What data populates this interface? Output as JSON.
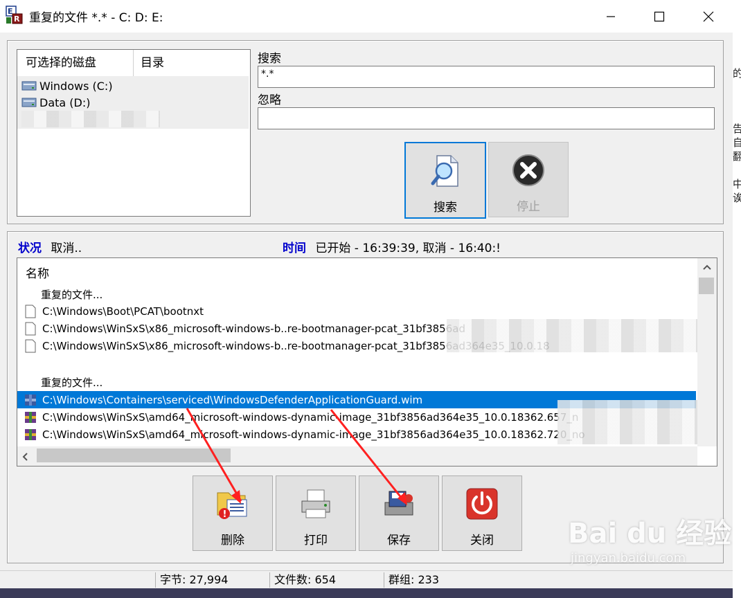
{
  "window": {
    "title": "重复的文件 *.* - C: D: E:",
    "minimize_glyph": "—",
    "maximize_glyph": "☐",
    "close_glyph": "✕"
  },
  "drives_panel": {
    "col_disks": "可选择的磁盘",
    "col_dir": "目录",
    "items": [
      {
        "label": "Windows (C:)"
      },
      {
        "label": "Data (D:)"
      }
    ]
  },
  "search": {
    "search_label": "搜索",
    "search_value": "*.*",
    "ignore_label": "忽略",
    "ignore_value": "",
    "search_button": "搜索",
    "stop_button": "停止"
  },
  "status": {
    "status_label": "状况",
    "status_value": "取消..",
    "time_label": "时间",
    "time_value": "已开始 - 16:39:39, 取消 - 16:40:!"
  },
  "results": {
    "header": "名称",
    "groups": [
      {
        "title": "重复的文件...",
        "files": [
          "C:\\Windows\\Boot\\PCAT\\bootnxt",
          "C:\\Windows\\WinSxS\\x86_microsoft-windows-b..re-bootmanager-pcat_31bf3856ad",
          "C:\\Windows\\WinSxS\\x86_microsoft-windows-b..re-bootmanager-pcat_31bf3856ad364e35_10.0.18"
        ]
      },
      {
        "title": "重复的文件...",
        "files": [
          "C:\\Windows\\Containers\\serviced\\WindowsDefenderApplicationGuard.wim",
          "C:\\Windows\\WinSxS\\amd64_microsoft-windows-dynamic-image_31bf3856ad364e35_10.0.18362.657_n",
          "C:\\Windows\\WinSxS\\amd64_microsoft-windows-dynamic-image_31bf3856ad364e35_10.0.18362.720_no"
        ]
      }
    ]
  },
  "actions": {
    "delete": "删除",
    "print": "打印",
    "save": "保存",
    "close": "关闭"
  },
  "statusbar": {
    "bytes": "字节: 27,994",
    "files": "文件数: 654",
    "groups": "群组: 233"
  },
  "right_strip": [
    "的",
    "",
    "",
    "",
    "告",
    "自",
    "翻",
    "",
    "中",
    "诶"
  ],
  "watermark": {
    "brand": "Bai du 经验",
    "url": "jingyan.baidu.com"
  },
  "colors": {
    "selection": "#0078d7",
    "status_label": "#0000cc",
    "arrow": "#ff2020",
    "close_button": "#d9342b"
  }
}
